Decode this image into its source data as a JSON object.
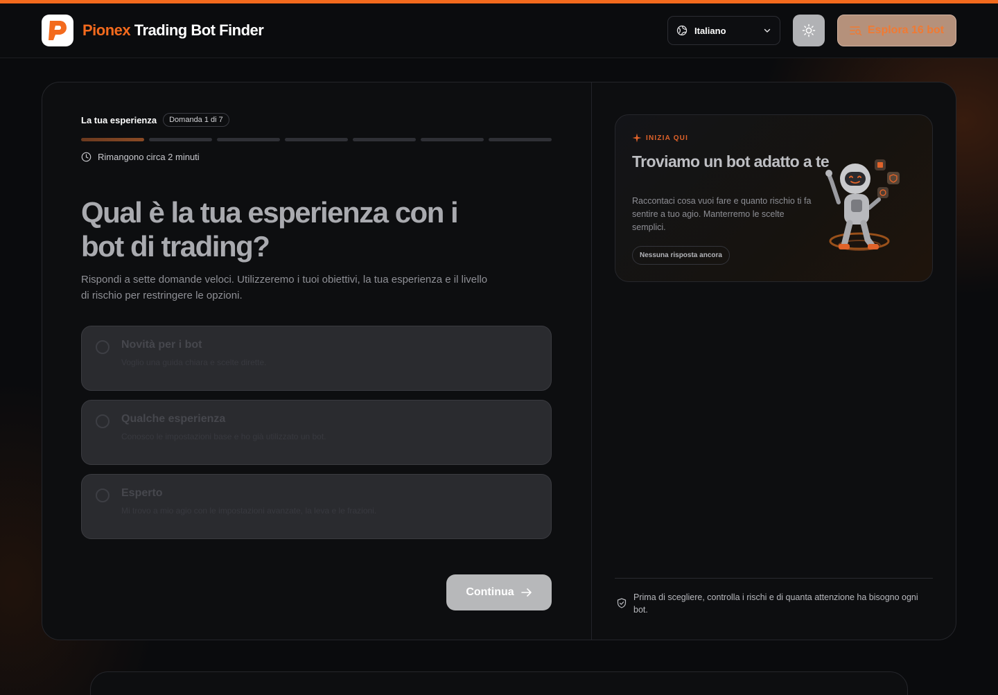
{
  "colors": {
    "accent": "#f36a1d",
    "background": "#0a0b0d",
    "card": "#0d0e10",
    "option_bg": "#2a2b2f",
    "continue_bg": "#b7b8ba",
    "explore_bg": "#b5917b"
  },
  "header": {
    "brand_accent": "Pionex",
    "brand_rest": " Trading Bot Finder",
    "language": {
      "icon": "globe-icon",
      "selected": "Italiano",
      "chevron": "chevron-down-icon"
    },
    "theme_toggle_icon": "sun-icon",
    "explore": {
      "icon": "list-search-icon",
      "label": "Esplora 16 bot"
    }
  },
  "quiz": {
    "step_title": "La tua esperienza",
    "step_badge": "Domanda 1 di 7",
    "progress": {
      "current": 1,
      "total": 7
    },
    "time_icon": "clock-icon",
    "time_remaining": "Rimangono circa 2 minuti",
    "question": "Qual è la tua esperienza con i bot di trading?",
    "subtitle": "Rispondi a sette domande veloci. Utilizzeremo i tuoi obiettivi, la tua esperienza e il livello di rischio per restringere le opzioni.",
    "options": [
      {
        "title": "Novità per i bot",
        "description": "Voglio una guida chiara e scelte dirette."
      },
      {
        "title": "Qualche esperienza",
        "description": "Conosco le impostazioni base e ho già utilizzato un bot."
      },
      {
        "title": "Esperto",
        "description": "Mi trovo a mio agio con le impostazioni avanzate, la leva e le frazioni."
      }
    ],
    "continue_label": "Continua",
    "continue_icon": "arrow-right-icon"
  },
  "info_card": {
    "kicker_icon": "sparkle-icon",
    "kicker": "INIZIA QUI",
    "title": "Troviamo un bot adatto a te",
    "text": "Raccontaci cosa vuoi fare e quanto rischio ti fa sentire a tuo agio. Manterremo le scelte semplici.",
    "chip": "Nessuna risposta ancora",
    "illustration": "robot-mascot-illustration"
  },
  "disclaimer": {
    "icon": "shield-check-icon",
    "text": "Prima di scegliere, controlla i rischi e di quanta attenzione ha bisogno ogni bot."
  }
}
